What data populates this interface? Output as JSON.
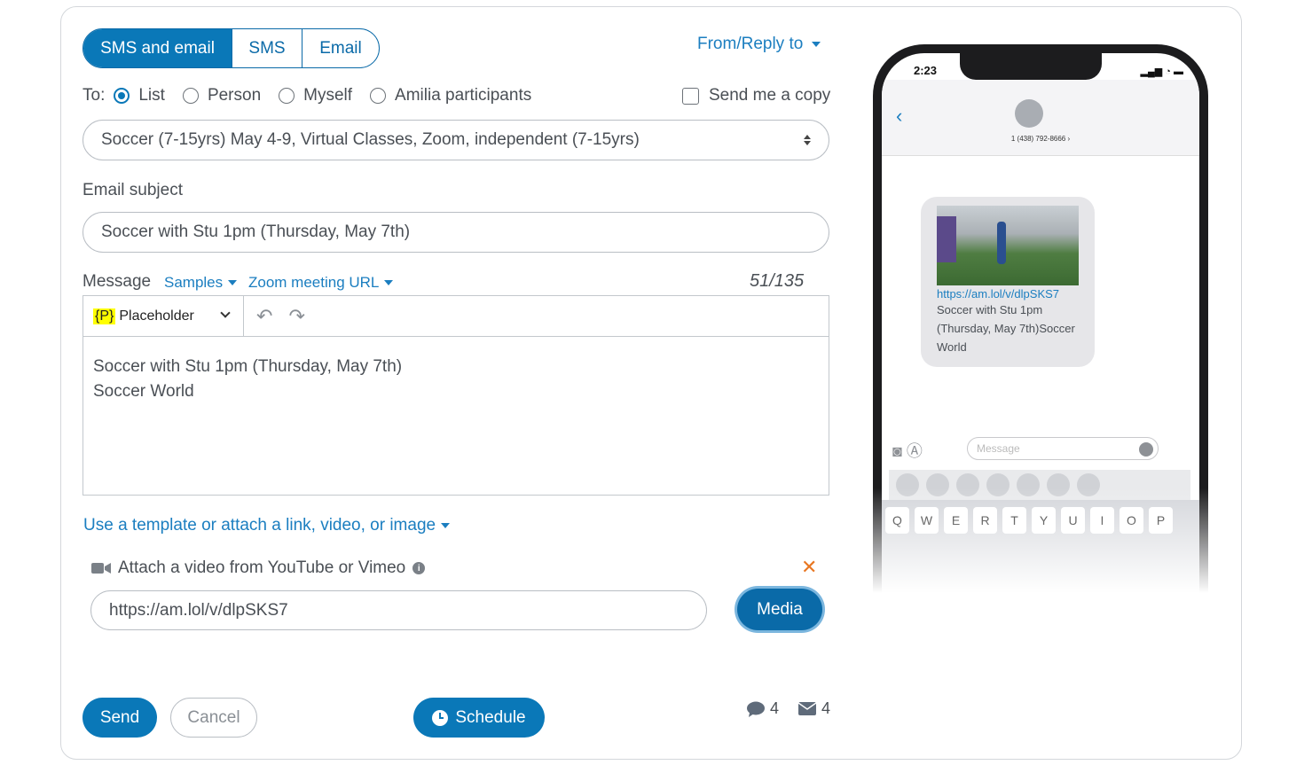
{
  "tabs": [
    "SMS and email",
    "SMS",
    "Email"
  ],
  "from_reply": "From/Reply to",
  "to": {
    "label": "To:",
    "options": [
      "List",
      "Person",
      "Myself",
      "Amilia participants"
    ],
    "send_copy": "Send me a copy"
  },
  "list_select": "Soccer (7-15yrs) May 4-9, Virtual Classes, Zoom, independent (7-15yrs)",
  "email_subject": {
    "label": "Email subject",
    "value": "Soccer with Stu 1pm (Thursday, May 7th)"
  },
  "message": {
    "label": "Message",
    "samples": "Samples",
    "zoom": "Zoom meeting URL",
    "counter": "51/135",
    "placeholder_tag": "{P}",
    "placeholder_label": "Placeholder",
    "line1": "Soccer with Stu 1pm (Thursday, May 7th)",
    "line2": "Soccer World"
  },
  "template_link": "Use a template or attach a link, video, or image",
  "attach": {
    "label": "Attach a video from YouTube or Vimeo",
    "url": "https://am.lol/v/dlpSKS7",
    "media_button": "Media"
  },
  "actions": {
    "send": "Send",
    "cancel": "Cancel",
    "schedule": "Schedule"
  },
  "counts": {
    "sms": "4",
    "email": "4"
  },
  "preview": {
    "time": "2:23",
    "number": "1 (438) 792-8666 ›",
    "link": "https://am.lol/v/dlpSKS7",
    "text": "Soccer with Stu 1pm (Thursday, May 7th)Soccer World",
    "input_placeholder": "Message",
    "keys": [
      "Q",
      "W",
      "E",
      "R",
      "T",
      "Y",
      "U",
      "I",
      "O",
      "P"
    ]
  }
}
